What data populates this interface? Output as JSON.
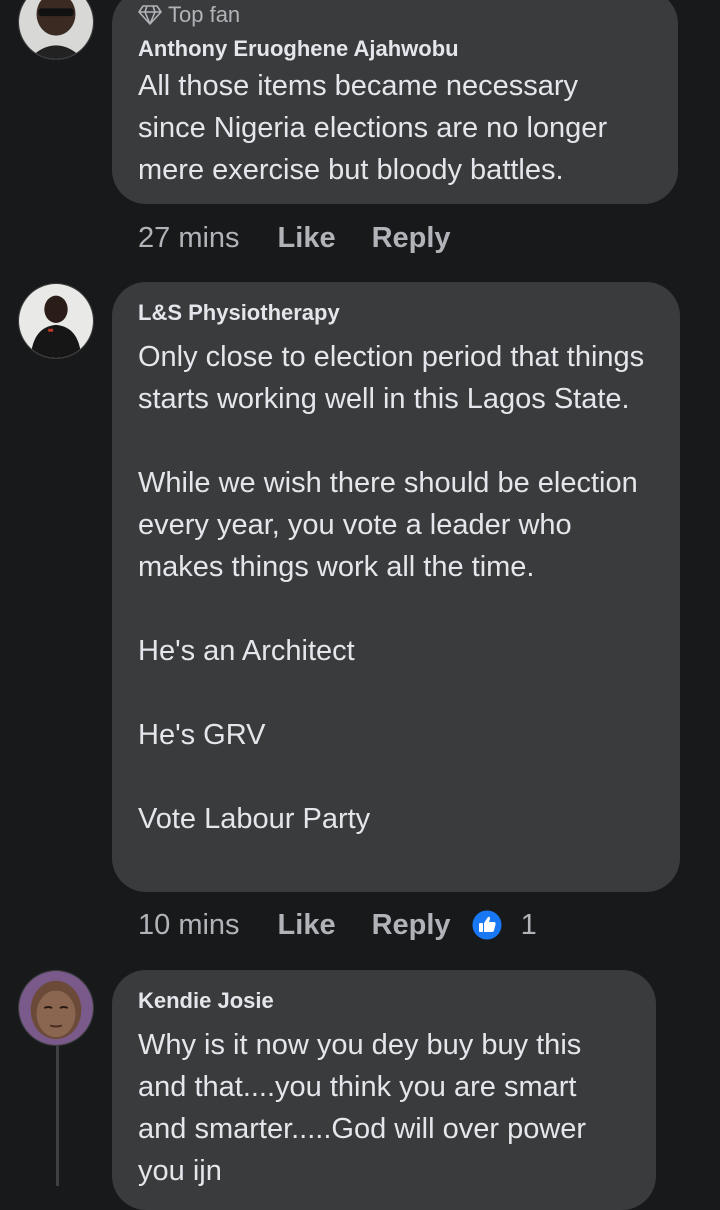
{
  "comments": [
    {
      "badge": "Top fan",
      "author": "Anthony Eruoghene Ajahwobu",
      "text": "All those items became necessary since Nigeria elections are no longer mere exercise but bloody battles.",
      "time": "27 mins",
      "like_label": "Like",
      "reply_label": "Reply"
    },
    {
      "author": "L&S Physiotherapy",
      "text": "Only close to election period that things starts working well in this Lagos State.\n\nWhile we wish there should be election every year, you vote a leader who makes things work all the time.\n\nHe's an Architect\n\nHe's GRV\n\nVote Labour Party",
      "time": "10 mins",
      "like_label": "Like",
      "reply_label": "Reply",
      "reaction_count": "1",
      "reaction_icon": "like-reaction-icon",
      "reaction_color": "#1877f2"
    },
    {
      "author": "Kendie Josie",
      "text": "Why is it now you dey buy buy this and that....you think you are smart and smarter.....God will over power you ijn"
    }
  ]
}
